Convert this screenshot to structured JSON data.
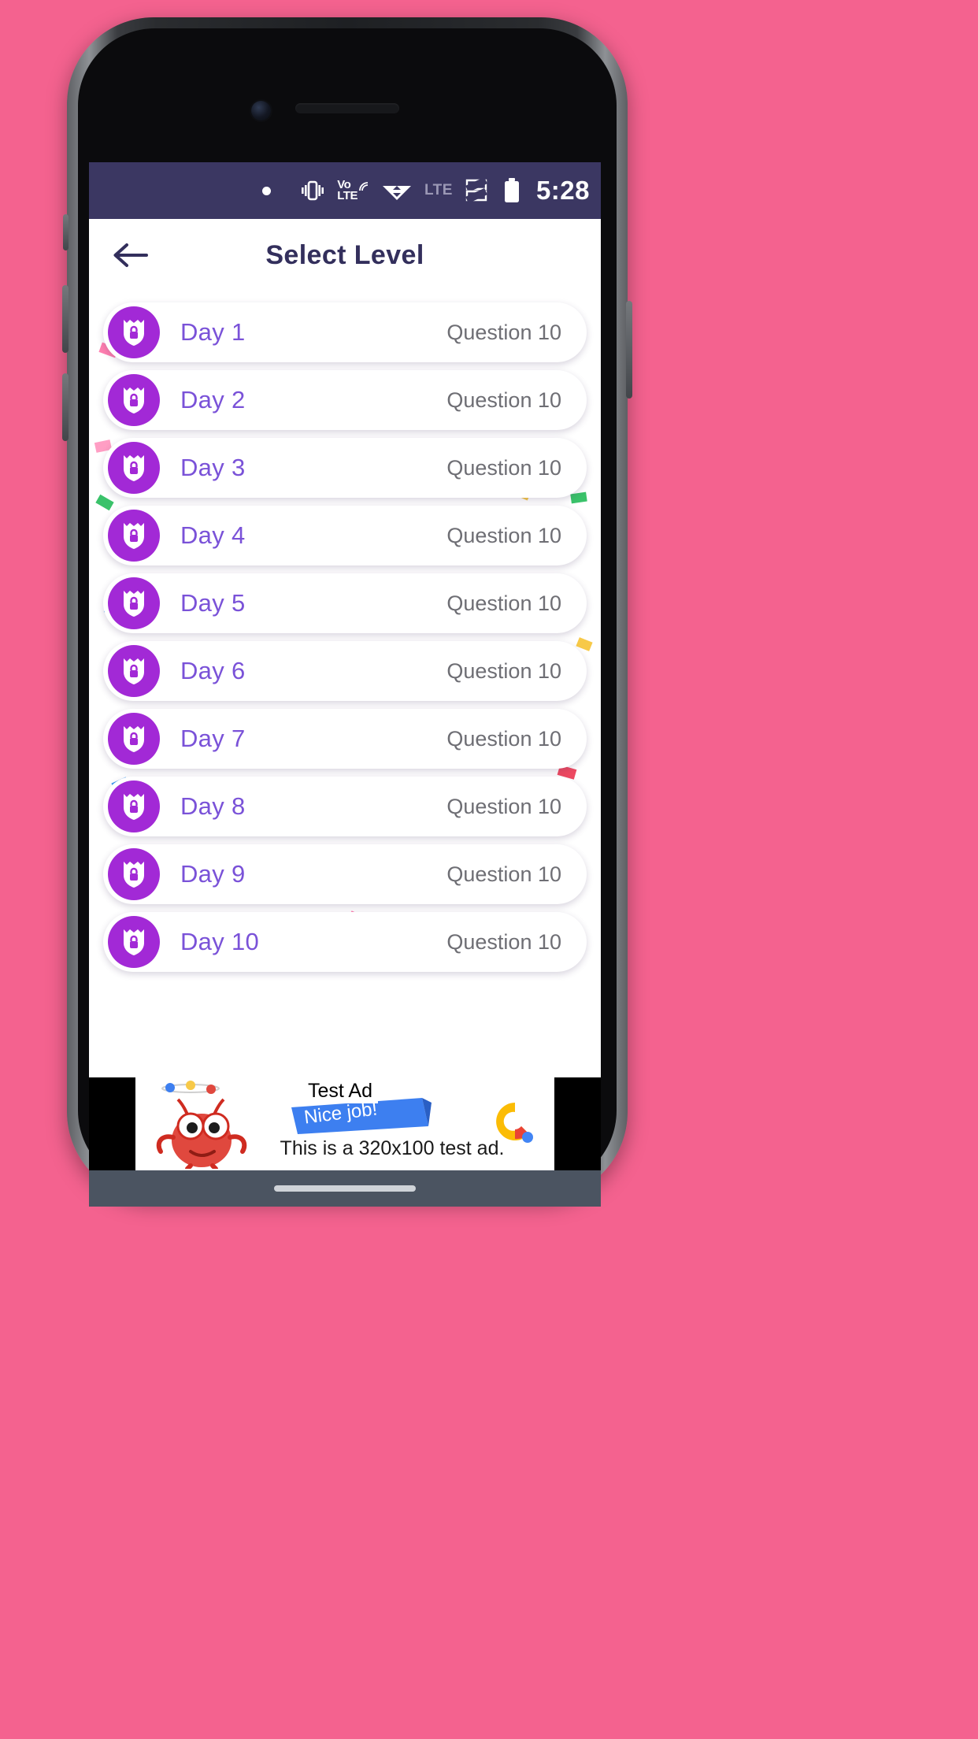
{
  "colors": {
    "background": "#f4628f",
    "status_bar": "#3b3762",
    "title": "#332f5c",
    "badge_purple": "#a229d6",
    "level_label": "#7a52d8",
    "question_gray": "#6e6e74",
    "nav_bar": "#4b5461"
  },
  "status_bar": {
    "dot_icon": "dot-icon",
    "vibrate_icon": "vibrate-icon",
    "volte_top": "Vo",
    "volte_bottom": "LTE",
    "wifi_icon": "wifi-icon",
    "network_label": "LTE",
    "signal_icon": "signal-bars-icon",
    "battery_icon": "battery-icon",
    "time": "5:28"
  },
  "header": {
    "back_icon": "back-arrow-icon",
    "title": "Select Level"
  },
  "levels": [
    {
      "badge_icon": "shield-lock-icon",
      "label": "Day 1",
      "questions": "Question 10"
    },
    {
      "badge_icon": "shield-lock-icon",
      "label": "Day 2",
      "questions": "Question 10"
    },
    {
      "badge_icon": "shield-lock-icon",
      "label": "Day 3",
      "questions": "Question 10"
    },
    {
      "badge_icon": "shield-lock-icon",
      "label": "Day 4",
      "questions": "Question 10"
    },
    {
      "badge_icon": "shield-lock-icon",
      "label": "Day 5",
      "questions": "Question 10"
    },
    {
      "badge_icon": "shield-lock-icon",
      "label": "Day 6",
      "questions": "Question 10"
    },
    {
      "badge_icon": "shield-lock-icon",
      "label": "Day 7",
      "questions": "Question 10"
    },
    {
      "badge_icon": "shield-lock-icon",
      "label": "Day 8",
      "questions": "Question 10"
    },
    {
      "badge_icon": "shield-lock-icon",
      "label": "Day 9",
      "questions": "Question 10"
    },
    {
      "badge_icon": "shield-lock-icon",
      "label": "Day 10",
      "questions": "Question 10"
    }
  ],
  "ad": {
    "label": "Test Ad",
    "ribbon_text": "Nice job!",
    "body_text": "This is a 320x100 test ad.",
    "logo_icon": "google-ads-logo-icon",
    "mascot_icon": "red-monster-icon"
  },
  "device": {
    "earpiece_icon": "earpiece-speaker-icon",
    "camera_icon": "front-camera-icon",
    "home_button_icon": "home-button-icon",
    "nav_pill_icon": "gesture-pill-icon"
  }
}
